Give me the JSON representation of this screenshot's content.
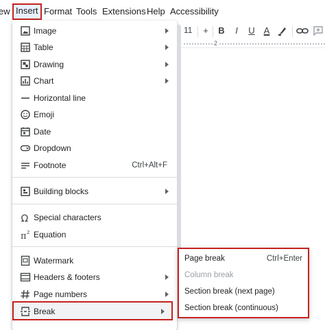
{
  "menubar": {
    "items": [
      {
        "label": "ew"
      },
      {
        "label": "Insert"
      },
      {
        "label": "Format"
      },
      {
        "label": "Tools"
      },
      {
        "label": "Extensions"
      },
      {
        "label": "Help"
      },
      {
        "label": "Accessibility"
      }
    ]
  },
  "toolbar": {
    "font_size": "11",
    "plus": "+",
    "bold": "B",
    "italic": "I",
    "underline": "U",
    "text_color": "A"
  },
  "ruler": {
    "mark": "2"
  },
  "insert_menu": {
    "items": [
      {
        "label": "Image",
        "icon": "image-icon"
      },
      {
        "label": "Table",
        "icon": "table-icon"
      },
      {
        "label": "Drawing",
        "icon": "drawing-icon"
      },
      {
        "label": "Chart",
        "icon": "chart-icon"
      },
      {
        "label": "Horizontal line",
        "icon": "horizontal-line-icon"
      },
      {
        "label": "Emoji",
        "icon": "emoji-icon"
      },
      {
        "label": "Date",
        "icon": "calendar-icon"
      },
      {
        "label": "Dropdown",
        "icon": "dropdown-icon"
      },
      {
        "label": "Footnote",
        "icon": "footnote-icon",
        "shortcut": "Ctrl+Alt+F"
      },
      {
        "label": "Building blocks",
        "icon": "building-blocks-icon"
      },
      {
        "label": "Special characters",
        "icon": "omega-icon"
      },
      {
        "label": "Equation",
        "icon": "pi-icon"
      },
      {
        "label": "Watermark",
        "icon": "watermark-icon"
      },
      {
        "label": "Headers & footers",
        "icon": "headers-footers-icon"
      },
      {
        "label": "Page numbers",
        "icon": "hash-icon"
      },
      {
        "label": "Break",
        "icon": "break-icon"
      }
    ]
  },
  "break_submenu": {
    "items": [
      {
        "label": "Page break",
        "shortcut": "Ctrl+Enter"
      },
      {
        "label": "Column break",
        "disabled": true
      },
      {
        "label": "Section break (next page)"
      },
      {
        "label": "Section break (continuous)"
      }
    ]
  },
  "colors": {
    "highlight_border": "#c5221f",
    "text": "#202124",
    "disabled": "#9aa0a6"
  }
}
